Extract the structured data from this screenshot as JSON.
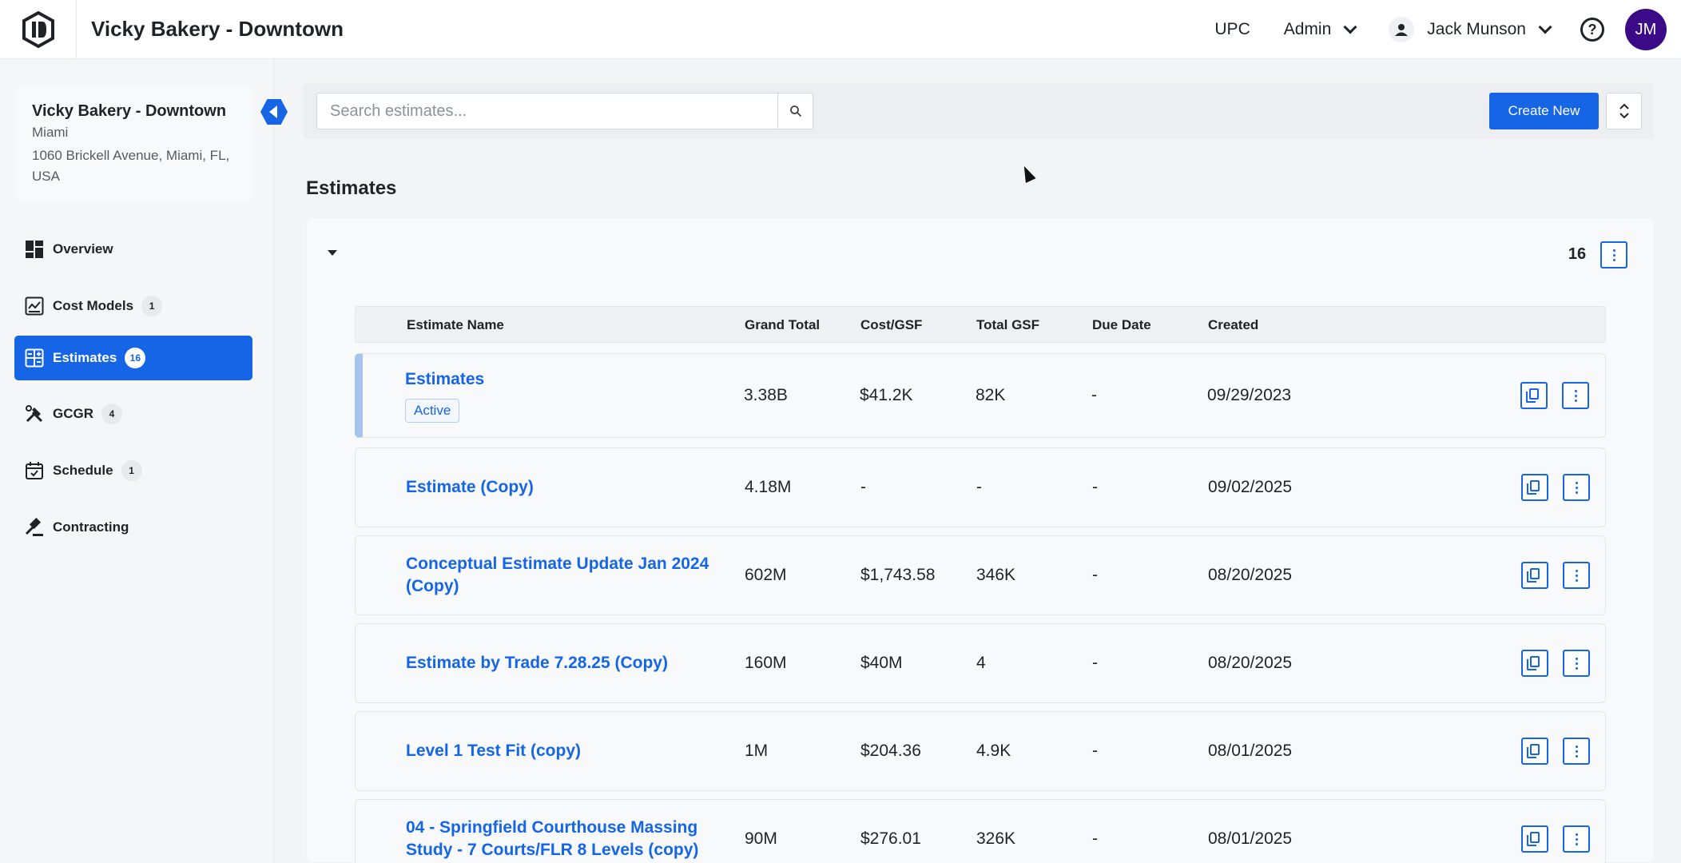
{
  "header": {
    "app_title": "Vicky Bakery - Downtown",
    "upc_label": "UPC",
    "admin_label": "Admin",
    "user_name": "Jack Munson",
    "avatar_initials": "JM",
    "help_glyph": "?"
  },
  "sidebar": {
    "project": {
      "name": "Vicky Bakery - Downtown",
      "city": "Miami",
      "address": "1060 Brickell Avenue, Miami, FL, USA"
    },
    "items": [
      {
        "label": "Overview",
        "icon": "dashboard-icon",
        "badge": ""
      },
      {
        "label": "Cost Models",
        "icon": "chart-icon",
        "badge": "1"
      },
      {
        "label": "Estimates",
        "icon": "calculator-icon",
        "badge": "16"
      },
      {
        "label": "GCGR",
        "icon": "tools-icon",
        "badge": "4"
      },
      {
        "label": "Schedule",
        "icon": "calendar-icon",
        "badge": "1"
      },
      {
        "label": "Contracting",
        "icon": "gavel-icon",
        "badge": ""
      }
    ]
  },
  "toolbar": {
    "search_placeholder": "Search estimates...",
    "create_label": "Create New"
  },
  "main": {
    "section_title": "Estimates",
    "group_count": "16",
    "columns": [
      "Estimate Name",
      "Grand Total",
      "Cost/GSF",
      "Total GSF",
      "Due Date",
      "Created"
    ],
    "rows": [
      {
        "name": "Estimates",
        "status": "Active",
        "grand_total": "3.38B",
        "cost_gsf": "$41.2K",
        "total_gsf": "82K",
        "due_date": "-",
        "created": "09/29/2023"
      },
      {
        "name": "Estimate (Copy)",
        "status": "",
        "grand_total": "4.18M",
        "cost_gsf": "-",
        "total_gsf": "-",
        "due_date": "-",
        "created": "09/02/2025"
      },
      {
        "name": "Conceptual Estimate Update Jan 2024 (Copy)",
        "status": "",
        "grand_total": "602M",
        "cost_gsf": "$1,743.58",
        "total_gsf": "346K",
        "due_date": "-",
        "created": "08/20/2025"
      },
      {
        "name": "Estimate by Trade 7.28.25 (Copy)",
        "status": "",
        "grand_total": "160M",
        "cost_gsf": "$40M",
        "total_gsf": "4",
        "due_date": "-",
        "created": "08/20/2025"
      },
      {
        "name": "Level 1 Test Fit (copy)",
        "status": "",
        "grand_total": "1M",
        "cost_gsf": "$204.36",
        "total_gsf": "4.9K",
        "due_date": "-",
        "created": "08/01/2025"
      },
      {
        "name": "04 - Springfield Courthouse Massing Study - 7 Courts/FLR 8 Levels (copy)",
        "status": "",
        "grand_total": "90M",
        "cost_gsf": "$276.01",
        "total_gsf": "326K",
        "due_date": "-",
        "created": "08/01/2025"
      }
    ]
  },
  "colors": {
    "accent": "#1565e6",
    "avatar_bg": "#3b0a86"
  }
}
